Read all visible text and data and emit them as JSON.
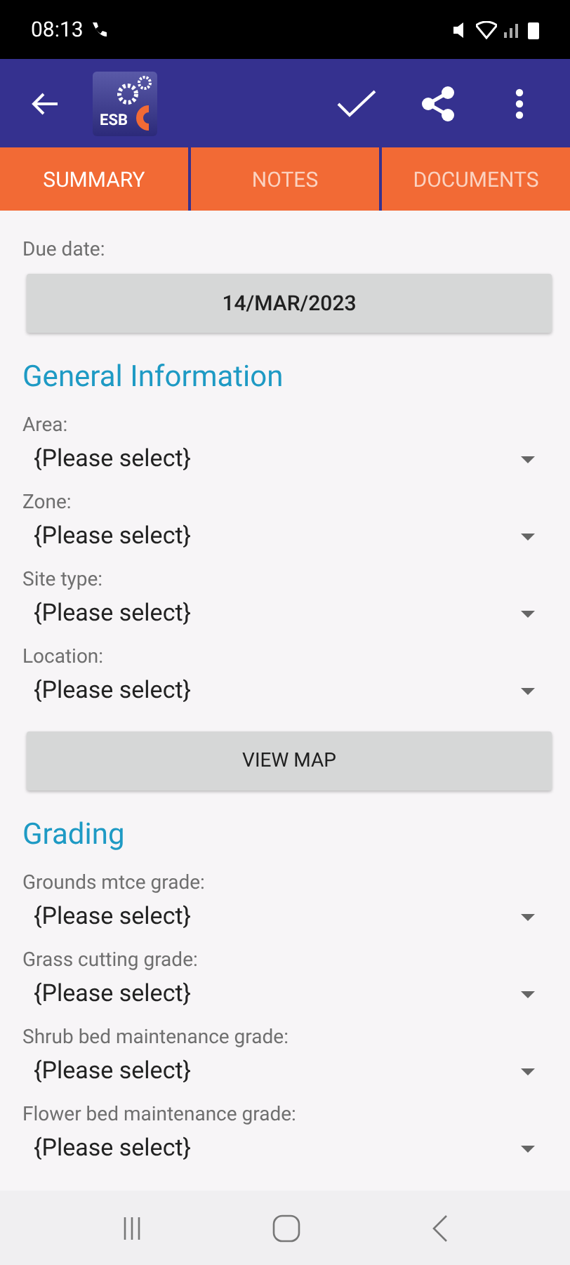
{
  "status_bar": {
    "time": "08:13"
  },
  "app_bar": {
    "logo_text": "ESB"
  },
  "tabs": [
    {
      "label": "SUMMARY",
      "selected": true
    },
    {
      "label": "NOTES",
      "selected": false
    },
    {
      "label": "DOCUMENTS",
      "selected": false
    }
  ],
  "form": [
    {
      "kind": "field",
      "label": "Due date:"
    },
    {
      "kind": "date_button",
      "label": "14/MAR/2023"
    },
    {
      "kind": "heading",
      "label": "General Information"
    },
    {
      "kind": "select",
      "label": "Area:",
      "value": "{Please select}"
    },
    {
      "kind": "select",
      "label": "Zone:",
      "value": "{Please select}"
    },
    {
      "kind": "select",
      "label": "Site type:",
      "value": "{Please select}"
    },
    {
      "kind": "select",
      "label": "Location:",
      "value": "{Please select}"
    },
    {
      "kind": "button",
      "label": "VIEW MAP"
    },
    {
      "kind": "heading",
      "label": "Grading"
    },
    {
      "kind": "select",
      "label": "Grounds mtce grade:",
      "value": "{Please select}"
    },
    {
      "kind": "select",
      "label": "Grass cutting grade:",
      "value": "{Please select}"
    },
    {
      "kind": "select",
      "label": "Shrub bed maintenance grade:",
      "value": "{Please select}"
    },
    {
      "kind": "select",
      "label": "Flower bed maintenance grade:",
      "value": "{Please select}"
    }
  ]
}
